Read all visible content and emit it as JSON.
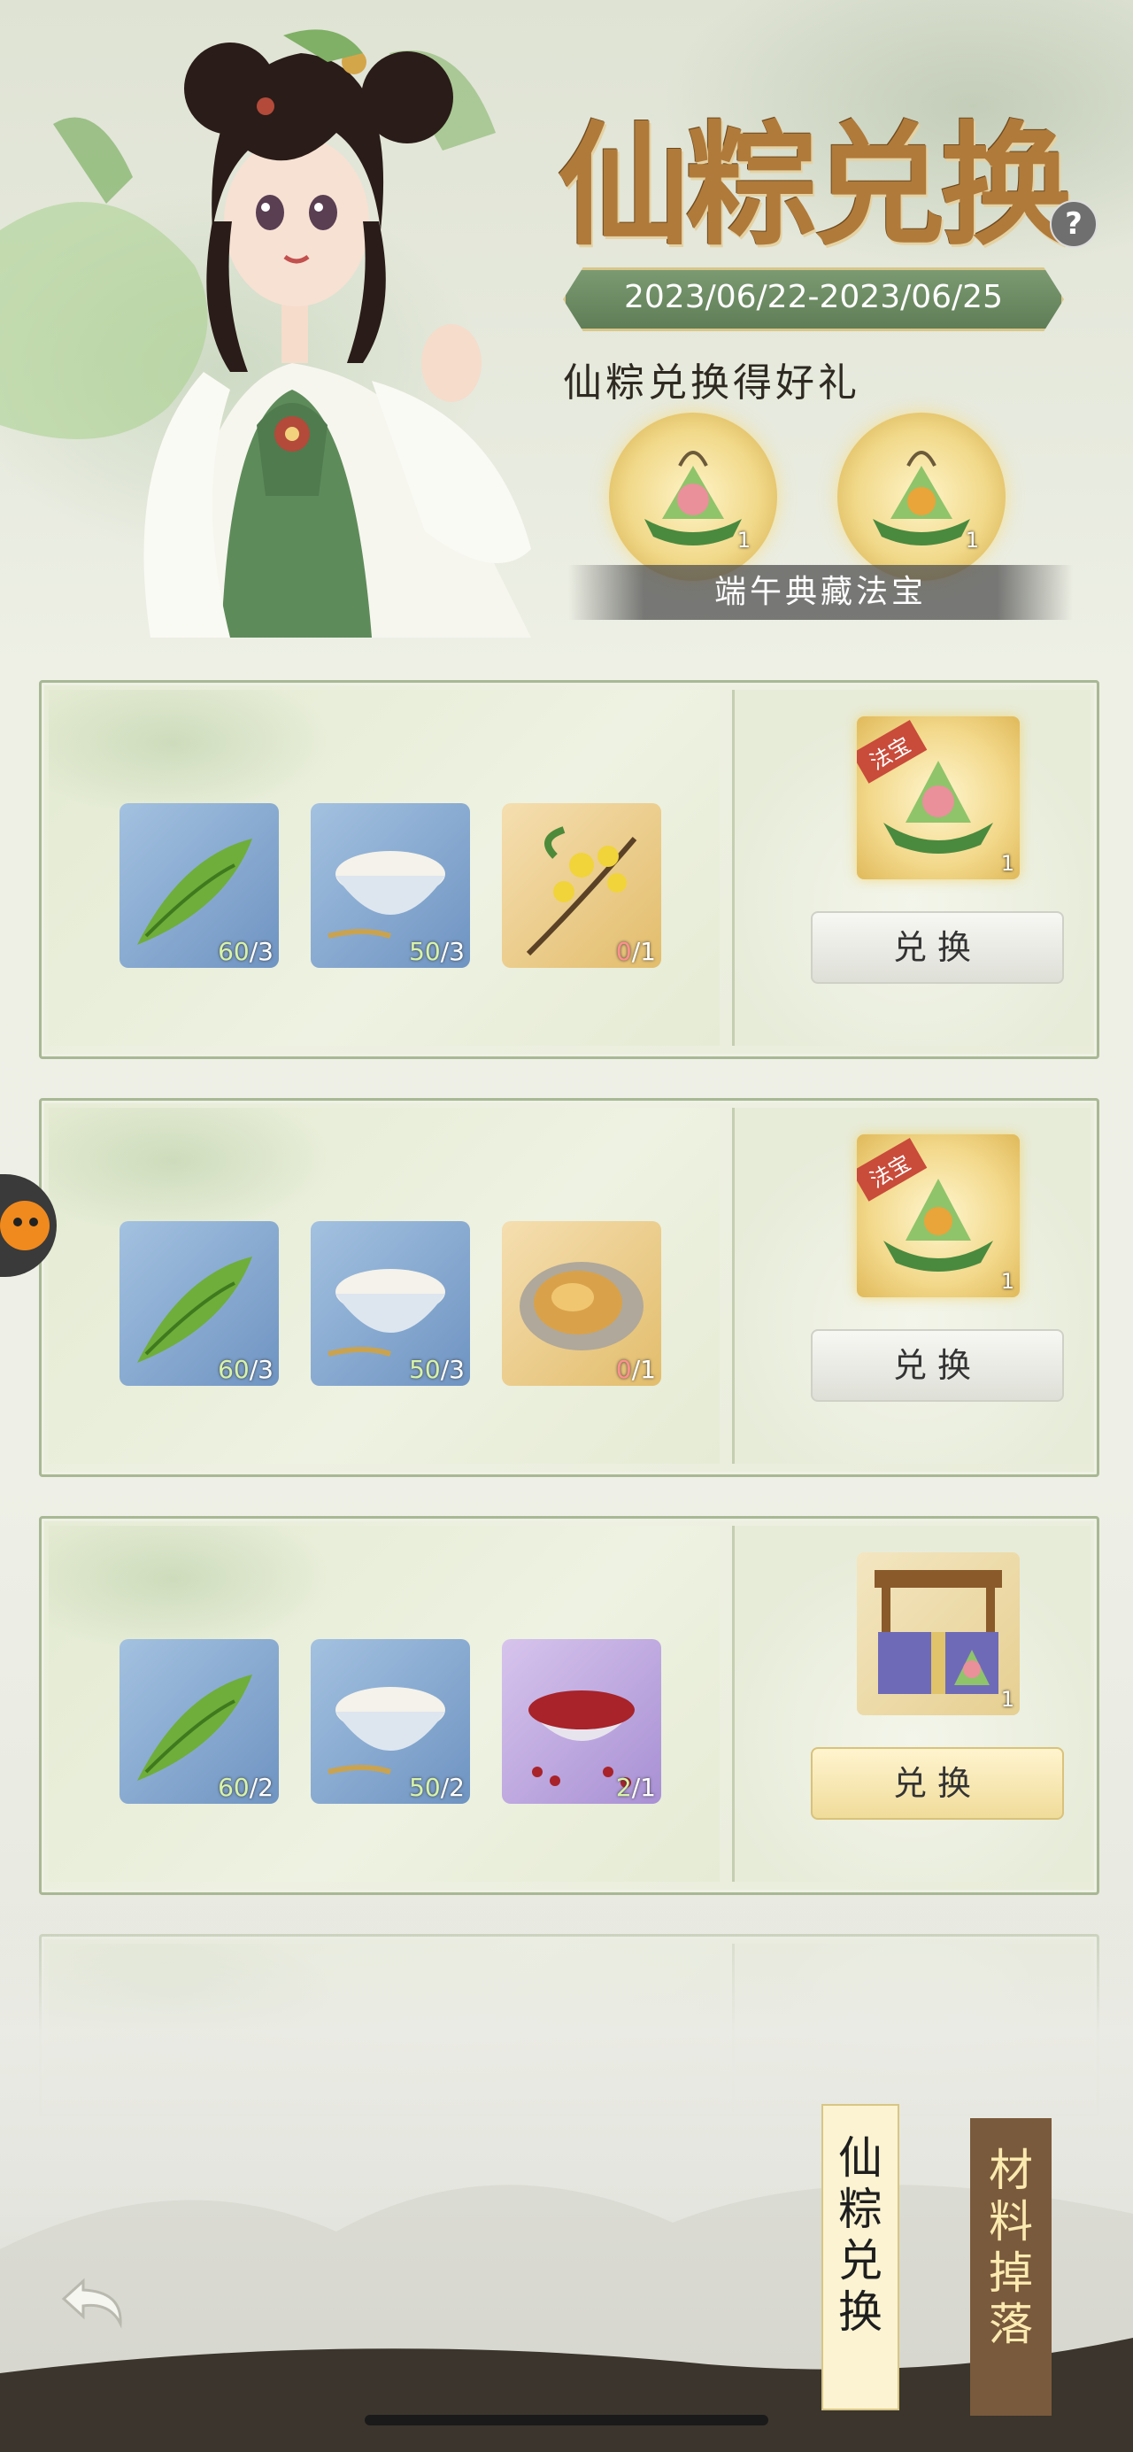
{
  "header": {
    "title": "仙粽兑换",
    "help_label": "?",
    "date_range": "2023/06/22-2023/06/25",
    "gift_title": "仙粽兑换得好礼",
    "gift_banner": "端午典藏法宝",
    "gift_items": [
      {
        "name": "zongzi-treasure-1",
        "qty": "1"
      },
      {
        "name": "zongzi-treasure-2",
        "qty": "1"
      }
    ]
  },
  "cards": [
    {
      "materials": [
        {
          "icon": "bamboo-leaf-icon",
          "have": "60",
          "need": "3",
          "lack": false,
          "bg": "blue"
        },
        {
          "icon": "rice-bowl-icon",
          "have": "50",
          "need": "3",
          "lack": false,
          "bg": "blue"
        },
        {
          "icon": "osmanthus-icon",
          "have": "0",
          "need": "1",
          "lack": true,
          "bg": "gold"
        }
      ],
      "reward": {
        "tag": "法宝",
        "qty": "1"
      },
      "button": "兑换",
      "active": false
    },
    {
      "materials": [
        {
          "icon": "bamboo-leaf-icon",
          "have": "60",
          "need": "3",
          "lack": false,
          "bg": "blue"
        },
        {
          "icon": "rice-bowl-icon",
          "have": "50",
          "need": "3",
          "lack": false,
          "bg": "blue"
        },
        {
          "icon": "abalone-icon",
          "have": "0",
          "need": "1",
          "lack": true,
          "bg": "gold"
        }
      ],
      "reward": {
        "tag": "法宝",
        "qty": "1"
      },
      "button": "兑换",
      "active": false
    },
    {
      "materials": [
        {
          "icon": "bamboo-leaf-icon",
          "have": "60",
          "need": "2",
          "lack": false,
          "bg": "blue"
        },
        {
          "icon": "rice-bowl-icon",
          "have": "50",
          "need": "2",
          "lack": false,
          "bg": "blue"
        },
        {
          "icon": "red-bean-icon",
          "have": "2",
          "need": "1",
          "lack": false,
          "bg": "purple"
        }
      ],
      "reward": {
        "tag": "",
        "qty": "1"
      },
      "button": "兑换",
      "active": true
    }
  ],
  "tabs": {
    "current": "仙粽兑换",
    "other": "材料掉落"
  }
}
